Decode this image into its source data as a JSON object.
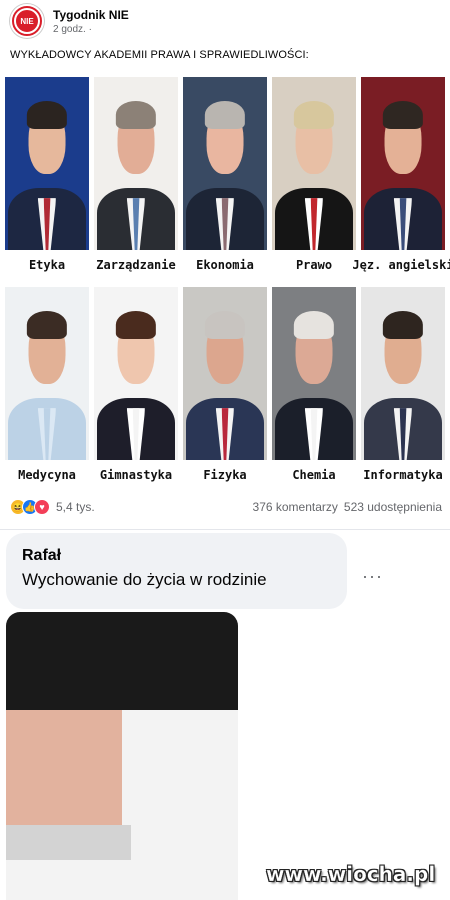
{
  "post": {
    "page_name": "Tygodnik NIE",
    "time": "2 godz. ·",
    "avatar_text": "NIE",
    "caption": "WYKŁADOWCY AKADEMII PRAWA I SPRAWIEDLIWOŚCI:"
  },
  "lecturers_row1": [
    {
      "subject": "Etyka",
      "bg": "#1b3c8c",
      "skin": "#e6b89c",
      "hair": "#2b2420",
      "suit": "#1d2742",
      "tie": "#b02a35",
      "shirt": "#f4f4f4"
    },
    {
      "subject": "Zarządzanie",
      "bg": "#f1efec",
      "skin": "#e2ad96",
      "hair": "#8c8177",
      "suit": "#2a2d33",
      "tie": "#5a7fb0",
      "shirt": "#f4f4f4"
    },
    {
      "subject": "Ekonomia",
      "bg": "#394a63",
      "skin": "#e9b6a0",
      "hair": "#b9b5b0",
      "suit": "#1d2536",
      "tie": "#8a6a70",
      "shirt": "#f4f4f4"
    },
    {
      "subject": "Prawo",
      "bg": "#d8cfc2",
      "skin": "#e8bfa5",
      "hair": "#d7c79d",
      "suit": "#151515",
      "tie": "#c1272d",
      "shirt": "#ffffff"
    },
    {
      "subject": "Jęz. angielski",
      "bg": "#7a1d24",
      "skin": "#e4b196",
      "hair": "#2f2722",
      "suit": "#1d2236",
      "tie": "#3a4d7a",
      "shirt": "#f4f4f4"
    }
  ],
  "lecturers_row2": [
    {
      "subject": "Medycyna",
      "bg": "#eef1f3",
      "skin": "#e2b196",
      "hair": "#3b2c24",
      "suit": "#bcd2e6",
      "tie": "#bcd2e6",
      "shirt": "#dbe8f4"
    },
    {
      "subject": "Gimnastyka",
      "bg": "#f4f4f4",
      "skin": "#efc6ae",
      "hair": "#4a2b1e",
      "suit": "#1e1e2a",
      "tie": "#f4f4f4",
      "shirt": "#ffffff"
    },
    {
      "subject": "Fizyka",
      "bg": "#c9c8c4",
      "skin": "#dca68e",
      "hair": "#c8c4c0",
      "suit": "#2a3655",
      "tie": "#b8283c",
      "shirt": "#f4f4f4"
    },
    {
      "subject": "Chemia",
      "bg": "#7d7f82",
      "skin": "#dca995",
      "hair": "#e6e3df",
      "suit": "#1b1f2a",
      "tie": "#f4f4f4",
      "shirt": "#ffffff"
    },
    {
      "subject": "Informatyka",
      "bg": "#e6e6e6",
      "skin": "#e0ad90",
      "hair": "#2e251f",
      "suit": "#34394a",
      "tie": "#2b3350",
      "shirt": "#f4f4f4"
    }
  ],
  "reactions": {
    "count": "5,4 tys.",
    "comments": "376 komentarzy",
    "shares": "523 udostępnienia"
  },
  "comment": {
    "author": "Rafał",
    "text": "Wychowanie do życia w rodzinie",
    "more": "···",
    "photo": {
      "bg": "#f3f3f3",
      "skin": "#e2b29e",
      "hair": "#d3d3d3",
      "suit": "#1a1a1a",
      "tie": "#1a1a1a",
      "shirt": "#f4f4f4"
    }
  },
  "watermark": "www.wiocha.pl"
}
